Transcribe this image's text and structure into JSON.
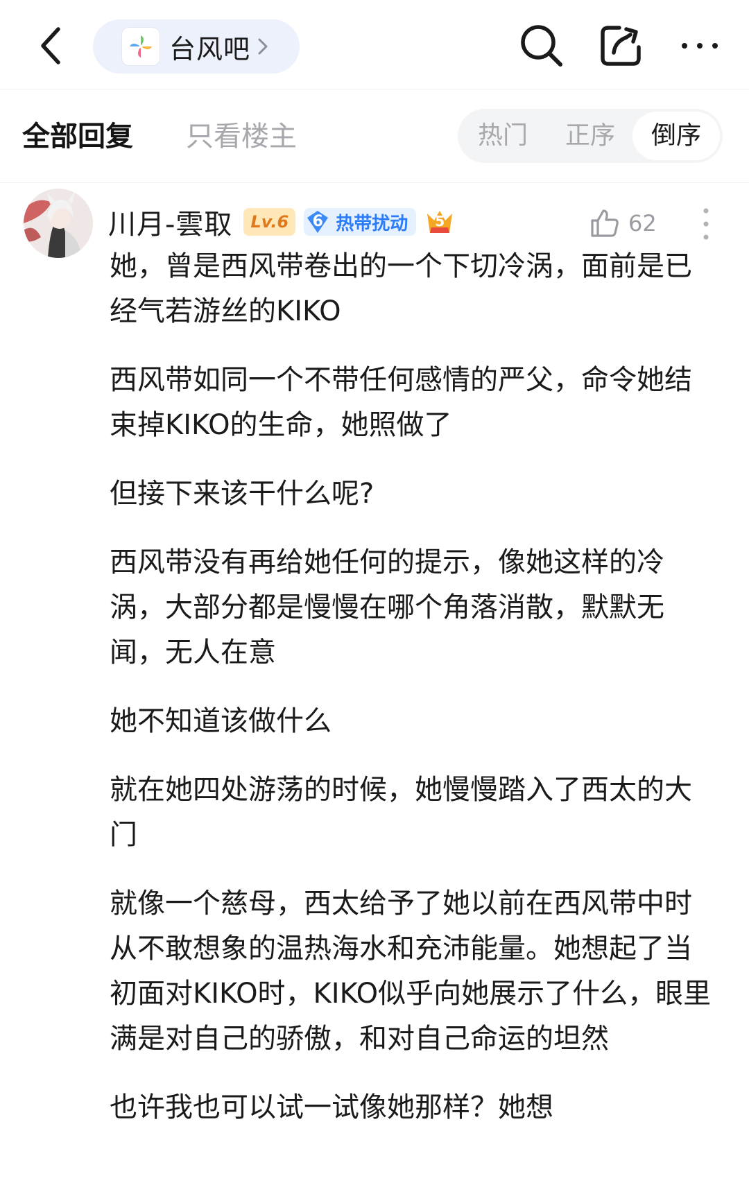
{
  "topbar": {
    "back_icon": "chevron-left-icon",
    "forum_name": "台风吧",
    "forum_icon": "pinwheel-logo-icon",
    "actions": [
      {
        "name": "search-icon"
      },
      {
        "name": "share-icon"
      },
      {
        "name": "more-horizontal-icon"
      }
    ]
  },
  "filters": {
    "tab_all": "全部回复",
    "tab_op": "只看楼主",
    "sort": [
      "热门",
      "正序",
      "倒序"
    ],
    "sort_selected": "倒序"
  },
  "post": {
    "author": "川月-雲取",
    "level": "Lv.6",
    "title_level": "6",
    "title_badge": "热带扰动",
    "member_level": "5",
    "likes": "62",
    "paragraphs": [
      "她，曾是西风带卷出的一个下切冷涡，面前是已经气若游丝的KIKO",
      "西风带如同一个不带任何感情的严父，命令她结束掉KIKO的生命，她照做了",
      "但接下来该干什么呢?",
      "西风带没有再给她任何的提示，像她这样的冷涡，大部分都是慢慢在哪个角落消散，默默无闻，无人在意",
      "她不知道该做什么",
      "就在她四处游荡的时候，她慢慢踏入了西太的大门",
      "就像一个慈母，西太给予了她以前在西风带中时从不敢想象的温热海水和充沛能量。她想起了当初面对KIKO时，KIKO似乎向她展示了什么，眼里满是对自己的骄傲，和对自己命运的坦然",
      "也许我也可以试一试像她那样？她想"
    ]
  },
  "colors": {
    "accent_blue": "#2b7cf6",
    "pill_bg": "#edf1fb",
    "muted_text": "#a7a7ad",
    "level_bg": "#ffe7b8",
    "level_text": "#e0781c"
  }
}
